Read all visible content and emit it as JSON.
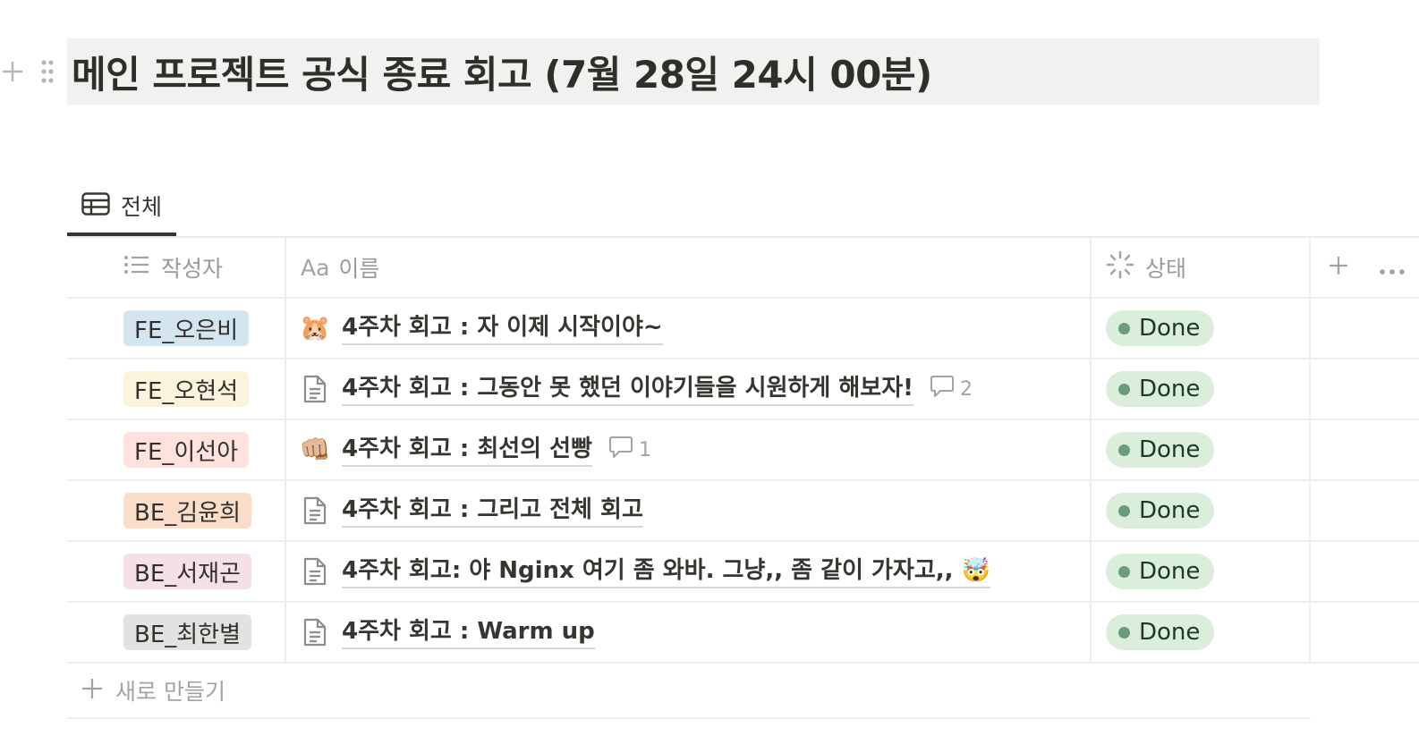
{
  "page": {
    "title": "메인 프로젝트 공식 종료 회고 (7월 28일 24시 00분)"
  },
  "view": {
    "tab_label": "전체",
    "tab_icon": "table-icon"
  },
  "table": {
    "columns": [
      {
        "label": "작성자",
        "icon": "list-icon"
      },
      {
        "label": "이름",
        "icon": "aa-icon",
        "icon_text": "Aa"
      },
      {
        "label": "상태",
        "icon": "status-icon"
      }
    ],
    "rows": [
      {
        "author": "FE_오은비",
        "author_color": "#d3e5ef",
        "icon": "hamster-emoji",
        "icon_char": "🐹",
        "name": "4주차 회고 : 자 이제 시작이야~",
        "comments": "",
        "status": "Done"
      },
      {
        "author": "FE_오현석",
        "author_color": "#fbf3db",
        "icon": "page-icon",
        "name": "4주차 회고 : 그동안 못 했던 이야기들을 시원하게 해보자!",
        "comments": "2",
        "status": "Done"
      },
      {
        "author": "FE_이선아",
        "author_color": "#ffe2dd",
        "icon": "fist-emoji",
        "icon_char": "👊🏼",
        "name": "4주차 회고 : 최선의 선빵",
        "comments": "1",
        "status": "Done"
      },
      {
        "author": "BE_김윤희",
        "author_color": "#fadec9",
        "icon": "page-icon",
        "name": "4주차 회고 : 그리고 전체 회고",
        "comments": "",
        "status": "Done"
      },
      {
        "author": "BE_서재곤",
        "author_color": "#f5e0e9",
        "icon": "page-icon",
        "name": "4주차 회고: 야 Nginx 여기 좀 와바. 그냥,, 좀 같이 가자고,, 🤯",
        "comments": "",
        "status": "Done"
      },
      {
        "author": "BE_최한별",
        "author_color": "#e3e2e0",
        "icon": "page-icon",
        "name": "4주차 회고 : Warm up",
        "comments": "",
        "status": "Done"
      }
    ],
    "new_row_label": "새로 만들기"
  },
  "colors": {
    "status_done_bg": "#dbeddb",
    "status_done_dot": "#6c9b7d",
    "heading_bg": "#f1f1ef"
  }
}
